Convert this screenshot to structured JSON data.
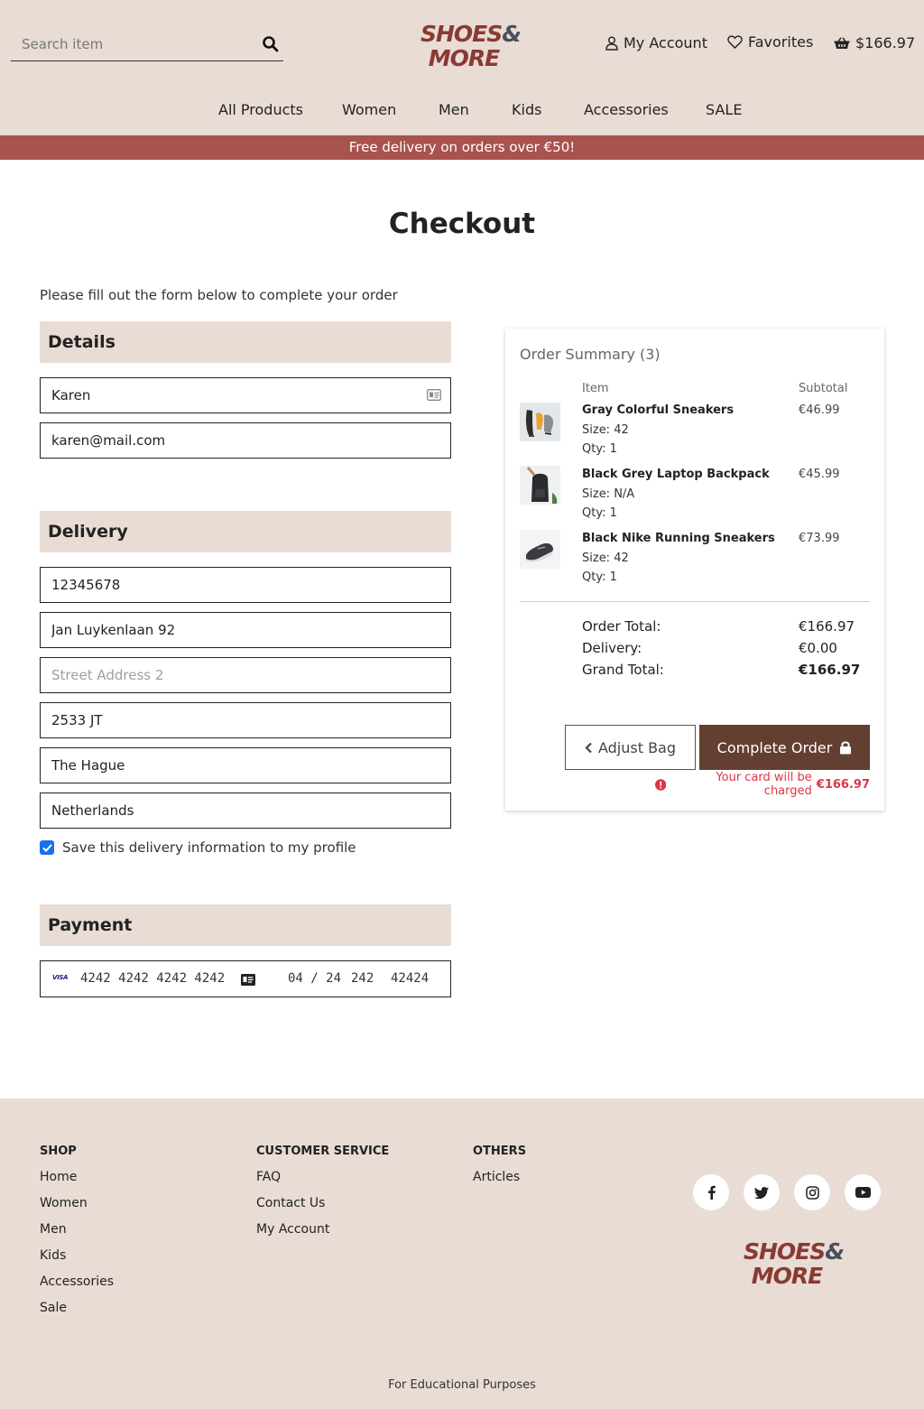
{
  "header": {
    "search_placeholder": "Search item",
    "logo_line1": "SHOES",
    "logo_amp": "&",
    "logo_line2": "MORE",
    "account_label": "My Account",
    "favorites_label": "Favorites",
    "cart_total": "$166.97"
  },
  "nav": [
    "All Products",
    "Women",
    "Men",
    "Kids",
    "Accessories",
    "SALE"
  ],
  "banner": "Free delivery on orders over €50!",
  "checkout": {
    "title": "Checkout",
    "subtitle": "Please fill out the form below to complete your order",
    "details_heading": "Details",
    "full_name": "Karen",
    "email": "karen@mail.com",
    "delivery_heading": "Delivery",
    "phone": "12345678",
    "street1": "Jan Luykenlaan 92",
    "street2_placeholder": "Street Address 2",
    "postcode": "2533 JT",
    "city": "The Hague",
    "country": "Netherlands",
    "save_label": "Save this delivery information to my profile",
    "save_checked": true,
    "payment_heading": "Payment",
    "card_brand": "VISA",
    "card_number": "4242 4242 4242 4242",
    "card_expiry": "04 / 24",
    "card_cvc": "242",
    "card_zip": "42424"
  },
  "summary": {
    "title": "Order Summary (3)",
    "col_item": "Item",
    "col_subtotal": "Subtotal",
    "items": [
      {
        "name": "Gray Colorful Sneakers",
        "size": "Size: 42",
        "qty": "Qty: 1",
        "price": "€46.99",
        "thumb_icon": "sneaker-icon"
      },
      {
        "name": "Black Grey Laptop Backpack",
        "size": "Size: N/A",
        "qty": "Qty: 1",
        "price": "€45.99",
        "thumb_icon": "backpack-icon"
      },
      {
        "name": "Black Nike Running Sneakers",
        "size": "Size: 42",
        "qty": "Qty: 1",
        "price": "€73.99",
        "thumb_icon": "sneaker-icon"
      }
    ],
    "order_total_label": "Order Total:",
    "order_total": "€166.97",
    "delivery_label": "Delivery:",
    "delivery": "€0.00",
    "grand_total_label": "Grand Total:",
    "grand_total": "€166.97",
    "adjust_label": "Adjust Bag",
    "complete_label": "Complete Order",
    "charge_text": "Your card will be charged",
    "charge_amount": "€166.97"
  },
  "footer": {
    "shop_heading": "SHOP",
    "shop_links": [
      "Home",
      "Women",
      "Men",
      "Kids",
      "Accessories",
      "Sale"
    ],
    "cs_heading": "CUSTOMER SERVICE",
    "cs_links": [
      "FAQ",
      "Contact Us",
      "My Account"
    ],
    "others_heading": "OTHERS",
    "others_links": [
      "Articles"
    ],
    "social": [
      "facebook-icon",
      "twitter-icon",
      "instagram-icon",
      "youtube-icon"
    ],
    "note": "For Educational Purposes"
  },
  "colors": {
    "header_bg": "#e8dcd5",
    "banner_bg": "#a8534e",
    "brand_red": "#8a3a33",
    "button_brown": "#633f31",
    "checkbox_blue": "#1a73e8",
    "error_red": "#dc3545"
  }
}
